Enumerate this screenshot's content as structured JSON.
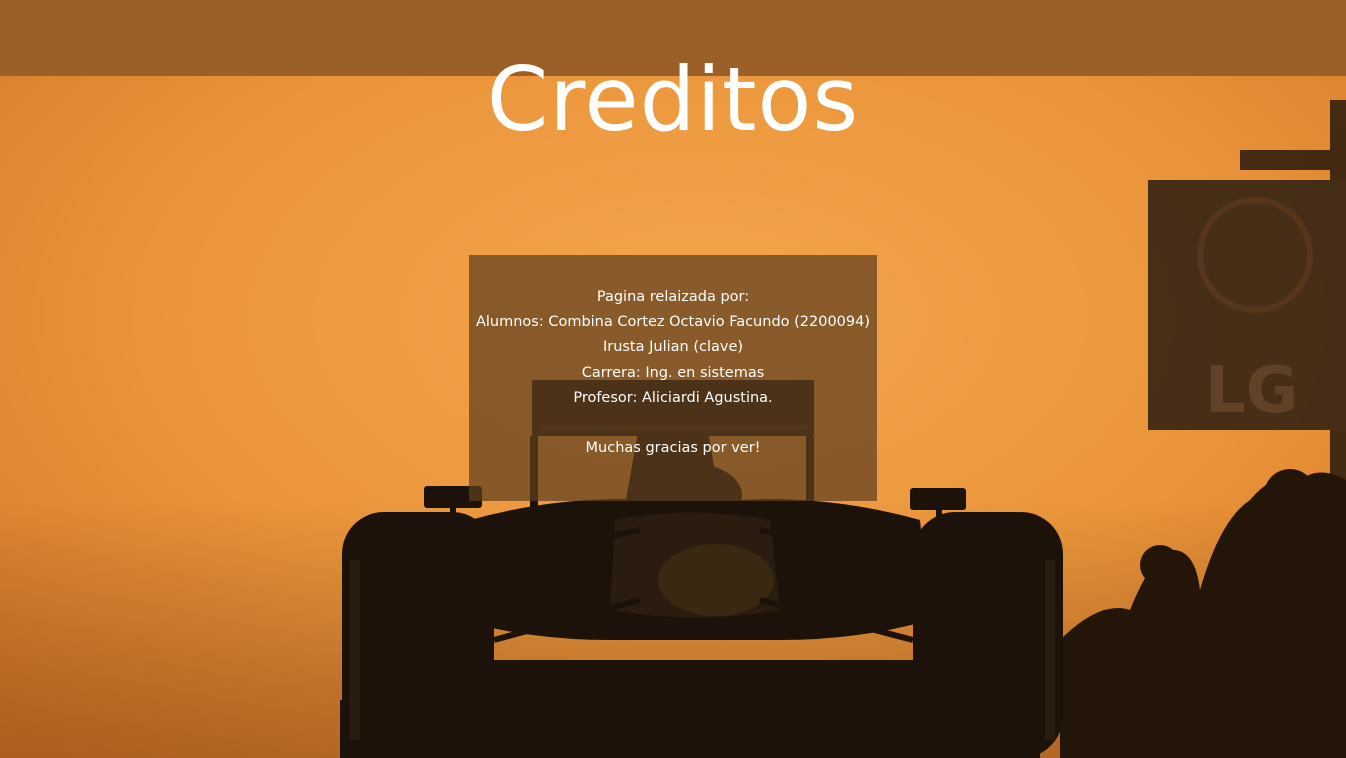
{
  "header": {
    "title": "Creditos"
  },
  "credits": {
    "intro": "Pagina relaizada por:",
    "students": "Alumnos: Combina Cortez Octavio Facundo (2200094)",
    "student2": "Irusta Julian (clave)",
    "career": "Carrera: Ing. en sistemas",
    "professor": "Profesor: Aliciardi Agustina.",
    "thanks": "Muchas gracias por ver!"
  },
  "background": {
    "sign_text": "LG"
  },
  "colors": {
    "header_bar": "#9a6028",
    "sky": "#e89238",
    "silhouette": "#1c120a"
  }
}
